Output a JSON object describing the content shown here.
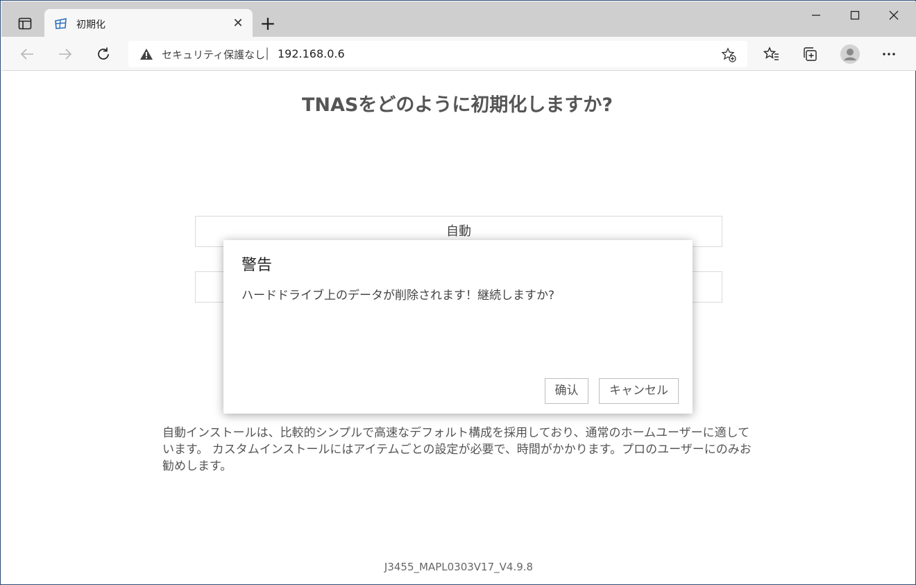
{
  "browser": {
    "tab": {
      "title": "初期化",
      "close": "✕"
    },
    "new_tab": "+",
    "window_controls": {
      "minimize": "—",
      "maximize": "☐",
      "close": "✕"
    },
    "address": {
      "security_label": "セキュリティ保護なし",
      "separator": "|",
      "url": "192.168.0.6"
    },
    "icons": {
      "tab_actions": "tab-actions-icon",
      "back": "arrow-left-icon",
      "forward": "arrow-right-icon",
      "refresh": "refresh-icon",
      "warning": "warning-icon",
      "add_favorite": "star-plus-icon",
      "favorites": "favorites-icon",
      "collections": "collections-icon",
      "profile": "profile-icon",
      "more": "more-icon"
    }
  },
  "page": {
    "title": "TNASをどのように初期化しますか?",
    "options": [
      {
        "label": "自動"
      },
      {
        "label": ""
      }
    ],
    "description": "自動インストールは、比較的シンプルで高速なデフォルト構成を採用しており、通常のホームユーザーに適しています。 カスタムインストールにはアイテムごとの設定が必要で、時間がかかります。プロのユーザーにのみお勧めします。",
    "version": "J3455_MAPL0303V17_V4.9.8"
  },
  "dialog": {
    "title": "警告",
    "message": "ハードドライブ上のデータが削除されます！継続しますか?",
    "confirm_label": "确认",
    "cancel_label": "キャンセル"
  },
  "colors": {
    "frame": "#2b4a73",
    "tabstrip": "#cfcfcf",
    "toolbar": "#f7f7f7",
    "title_text": "#555555"
  }
}
